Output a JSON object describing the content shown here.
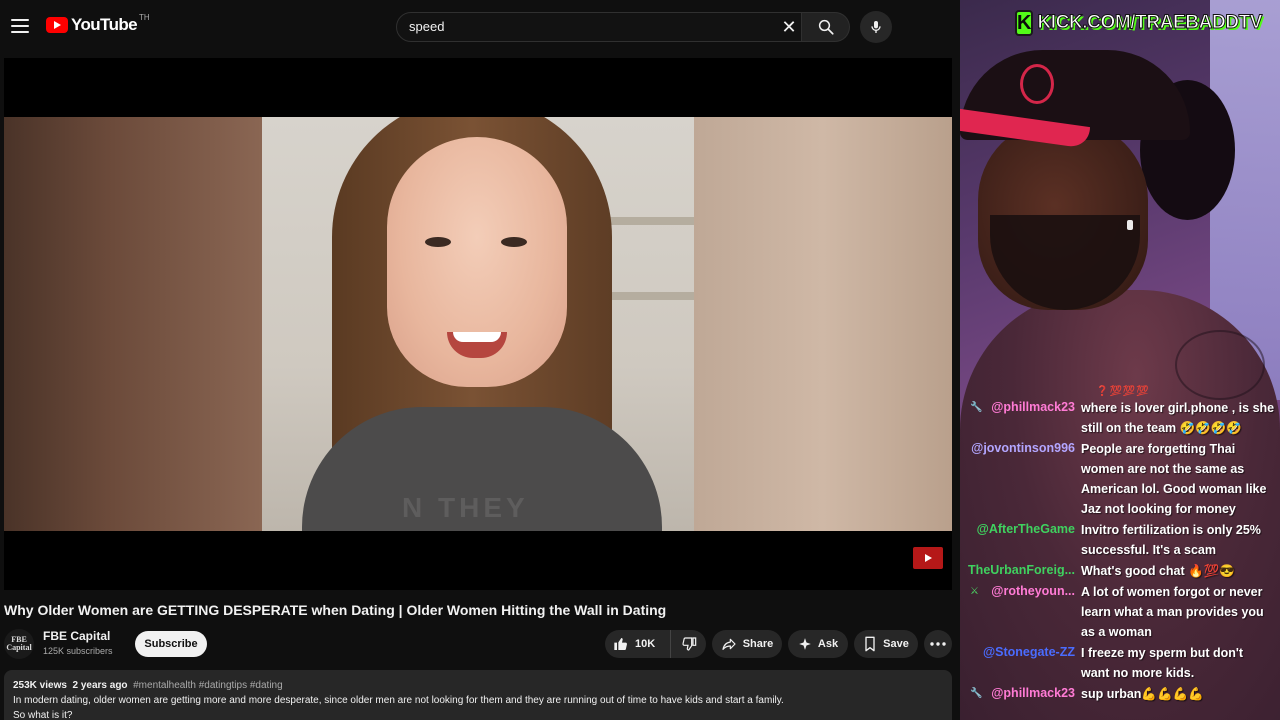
{
  "youtube": {
    "logo_text": "YouTube",
    "logo_region": "TH",
    "search": {
      "value": "speed",
      "placeholder": "Search"
    },
    "video": {
      "shirt_text": "N THEY",
      "title": "Why Older Women are GETTING DESPERATE when Dating | Older Women Hitting the Wall in Dating"
    },
    "channel": {
      "avatar_text": "FBE Capital",
      "name": "FBE Capital",
      "subscribers": "125K subscribers",
      "subscribe_label": "Subscribe"
    },
    "actions": {
      "likes": "10K",
      "share": "Share",
      "ask": "Ask",
      "save": "Save"
    },
    "description": {
      "views": "253K views",
      "age": "2 years ago",
      "tags": "#mentalhealth #datingtips #dating",
      "text": "In modern dating, older women are getting more and more desperate, since older men are not looking for them and they are running out of time to have kids and start a family.",
      "line2": "So what is it?"
    }
  },
  "stream": {
    "banner": "KICK.COM/TRAEBADDTV",
    "banner_k": "K",
    "chat": [
      {
        "user": "",
        "emotes": "❓💯💯💯",
        "lines": []
      },
      {
        "user": "@phillmack23",
        "color": "#ff7bd5",
        "badge": "wrench",
        "lines": [
          "where is lover girl.phone , is she",
          "still on the team 🤣🤣🤣🤣"
        ]
      },
      {
        "user": "@jovontinson996",
        "color": "#b3a6ff",
        "badge": "",
        "lines": [
          "People are forgetting Thai",
          "women are not the same as",
          "American lol. Good woman like",
          "Jaz not looking for money"
        ]
      },
      {
        "user": "@AfterTheGame",
        "color": "#3fd15f",
        "badge": "",
        "lines": [
          "Invitro fertilization is only 25%",
          "successful. It's a scam"
        ]
      },
      {
        "user": "TheUrbanForeig...",
        "color": "#3fd15f",
        "badge": "",
        "lines": [
          "What's good chat 🔥💯😎"
        ]
      },
      {
        "user": "@rotheyoun...",
        "color": "#ff7bd5",
        "badge": "mod",
        "lines": [
          "A lot of women forgot or never",
          "learn what a man provides you",
          "as a woman"
        ]
      },
      {
        "user": "@Stonegate-ZZ",
        "color": "#4a6cff",
        "badge": "",
        "lines": [
          "I freeze my sperm but don't",
          "want no more kids."
        ]
      },
      {
        "user": "@phillmack23",
        "color": "#ff7bd5",
        "badge": "wrench",
        "lines": [
          "sup urban💪💪💪💪"
        ]
      }
    ]
  }
}
